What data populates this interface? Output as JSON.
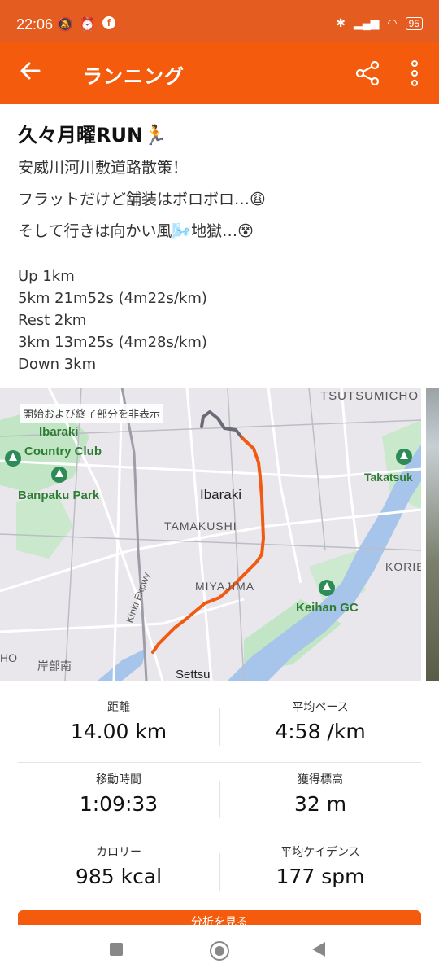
{
  "status_bar": {
    "time": "22:06",
    "battery": "95"
  },
  "app_bar": {
    "title": "ランニング",
    "back_icon": "arrow-left-icon",
    "share_icon": "share-icon",
    "more_icon": "more-vertical-icon"
  },
  "post": {
    "title": "久々月曜RUN🏃",
    "description": [
      "安威川河川敷道路散策！",
      "フラットだけど舗装はボロボロ…😩",
      "そして行きは向かい風🌬️地獄…😵"
    ],
    "splits": [
      "Up 1km",
      "5km 21m52s (4m22s/km)",
      "Rest 2km",
      "3km 13m25s (4m28s/km)",
      "Down 3km"
    ]
  },
  "map": {
    "hint": "開始および終了部分を非表示",
    "labels": {
      "tsutsumicho": "TSUTSUMICHO",
      "ibaraki_cc_1": "Ibaraki",
      "ibaraki_cc_2": "Country Club",
      "banpaku": "Banpaku Park",
      "ibaraki": "Ibaraki",
      "tamakushi": "TAMAKUSHI",
      "miyajima": "MIYAJIMA",
      "takatsuki": "Takatsuk",
      "korie": "KORIE",
      "keihan": "Keihan GC",
      "kinki": "Kinki Expwy",
      "kishibe": "岸部南",
      "settsu": "Settsu",
      "ho": "HO"
    },
    "colors": {
      "route": "#f05a12",
      "hidden_route": "#6b6b78",
      "water": "#a7c5ea",
      "park": "#c2e5c6"
    }
  },
  "stats": [
    {
      "label": "距離",
      "value": "14.00 km"
    },
    {
      "label": "平均ペース",
      "value": "4:58 /km"
    },
    {
      "label": "移動時間",
      "value": "1:09:33"
    },
    {
      "label": "獲得標高",
      "value": "32 m"
    },
    {
      "label": "カロリー",
      "value": "985 kcal"
    },
    {
      "label": "平均ケイデンス",
      "value": "177 spm"
    }
  ],
  "cta": {
    "label": "分析を見る"
  },
  "nav": {
    "recents_icon": "square-icon",
    "home_icon": "circle-icon",
    "back_icon": "triangle-back-icon"
  }
}
